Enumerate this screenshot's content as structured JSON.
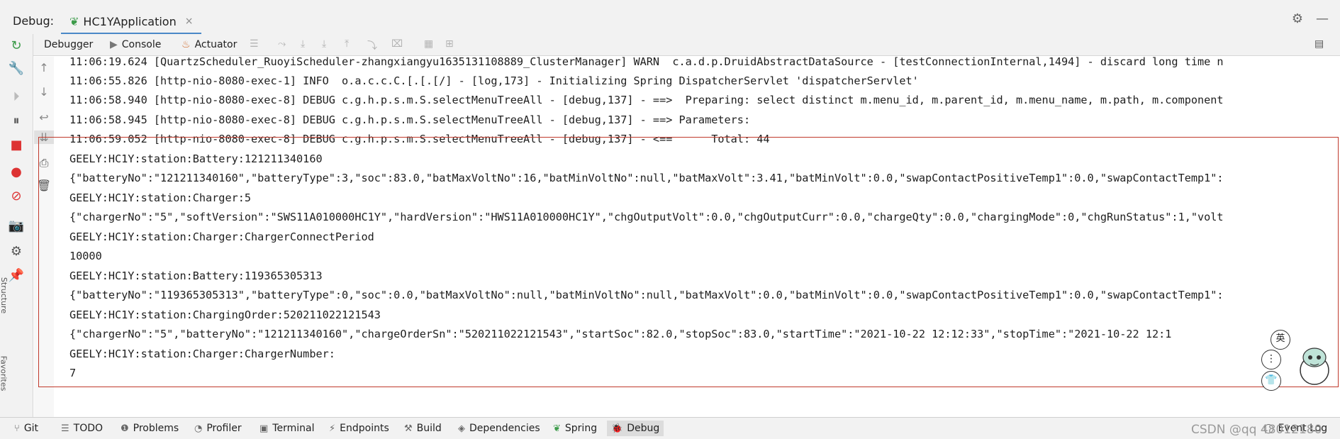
{
  "titlebar": {
    "panel_label": "Debug:",
    "run_tab_label": "HC1YApplication"
  },
  "toolbar": {
    "debugger_label": "Debugger",
    "console_label": "Console",
    "actuator_label": "Actuator"
  },
  "console": {
    "lines": [
      "11:06:19.624 [QuartzScheduler_RuoyiScheduler-zhangxiangyu1635131108889_ClusterManager] WARN  c.a.d.p.DruidAbstractDataSource - [testConnectionInternal,1494] - discard long time n",
      "11:06:55.826 [http-nio-8080-exec-1] INFO  o.a.c.c.C.[.[.[/] - [log,173] - Initializing Spring DispatcherServlet 'dispatcherServlet'",
      "11:06:58.940 [http-nio-8080-exec-8] DEBUG c.g.h.p.s.m.S.selectMenuTreeAll - [debug,137] - ==>  Preparing: select distinct m.menu_id, m.parent_id, m.menu_name, m.path, m.component",
      "11:06:58.945 [http-nio-8080-exec-8] DEBUG c.g.h.p.s.m.S.selectMenuTreeAll - [debug,137] - ==> Parameters:",
      "11:06:59.052 [http-nio-8080-exec-8] DEBUG c.g.h.p.s.m.S.selectMenuTreeAll - [debug,137] - <==      Total: 44",
      "GEELY:HC1Y:station:Battery:121211340160",
      "{\"batteryNo\":\"121211340160\",\"batteryType\":3,\"soc\":83.0,\"batMaxVoltNo\":16,\"batMinVoltNo\":null,\"batMaxVolt\":3.41,\"batMinVolt\":0.0,\"swapContactPositiveTemp1\":0.0,\"swapContactTemp1\":",
      "GEELY:HC1Y:station:Charger:5",
      "{\"chargerNo\":\"5\",\"softVersion\":\"SWS11A010000HC1Y\",\"hardVersion\":\"HWS11A010000HC1Y\",\"chgOutputVolt\":0.0,\"chgOutputCurr\":0.0,\"chargeQty\":0.0,\"chargingMode\":0,\"chgRunStatus\":1,\"volt",
      "GEELY:HC1Y:station:Charger:ChargerConnectPeriod",
      "10000",
      "GEELY:HC1Y:station:Battery:119365305313",
      "{\"batteryNo\":\"119365305313\",\"batteryType\":0,\"soc\":0.0,\"batMaxVoltNo\":null,\"batMinVoltNo\":null,\"batMaxVolt\":0.0,\"batMinVolt\":0.0,\"swapContactPositiveTemp1\":0.0,\"swapContactTemp1\":",
      "GEELY:HC1Y:station:ChargingOrder:520211022121543",
      "{\"chargerNo\":\"5\",\"batteryNo\":\"121211340160\",\"chargeOrderSn\":\"520211022121543\",\"startSoc\":82.0,\"stopSoc\":83.0,\"startTime\":\"2021-10-22 12:12:33\",\"stopTime\":\"2021-10-22 12:1",
      "GEELY:HC1Y:station:Charger:ChargerNumber:",
      "7"
    ]
  },
  "sidebar": {
    "structure_label": "Structure",
    "favorites_label": "Favorites"
  },
  "bottombar": {
    "git_label": "Git",
    "todo_label": "TODO",
    "problems_label": "Problems",
    "profiler_label": "Profiler",
    "terminal_label": "Terminal",
    "endpoints_label": "Endpoints",
    "build_label": "Build",
    "dependencies_label": "Dependencies",
    "spring_label": "Spring",
    "debug_label": "Debug",
    "eventlog_label": "Event Log",
    "watermark": "CSDN @qq 48012180"
  },
  "stickers": {
    "bubble_text": "英"
  }
}
